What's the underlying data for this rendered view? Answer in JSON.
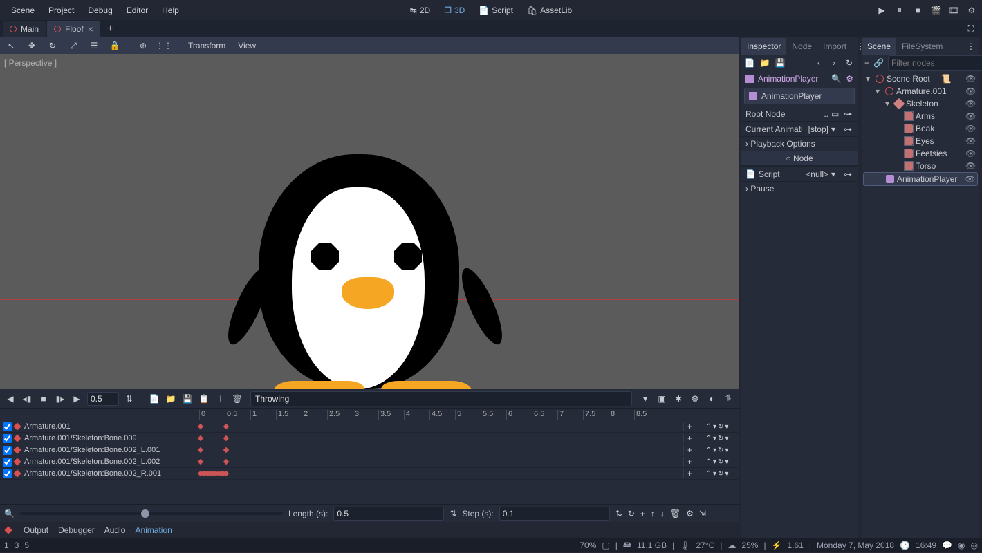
{
  "menubar": {
    "items": [
      "Scene",
      "Project",
      "Debug",
      "Editor",
      "Help"
    ],
    "center": [
      {
        "label": "2D",
        "icon": "swap"
      },
      {
        "label": "3D",
        "icon": "cube",
        "active": true
      },
      {
        "label": "Script",
        "icon": "script"
      },
      {
        "label": "AssetLib",
        "icon": "bag"
      }
    ]
  },
  "tabs": [
    {
      "name": "Main",
      "active": false
    },
    {
      "name": "Floof",
      "active": true,
      "closable": true
    }
  ],
  "toolbar3d": {
    "menus": [
      "Transform",
      "View"
    ]
  },
  "viewport": {
    "label": "[ Perspective ]"
  },
  "animation": {
    "toolbar": {
      "pos": "0.5",
      "name": "Throwing"
    },
    "ruler": [
      "0",
      "0.5",
      "1",
      "1.5",
      "2",
      "2.5",
      "3",
      "3.5",
      "4",
      "4.5",
      "5",
      "5.5",
      "6",
      "6.5",
      "7",
      "7.5",
      "8",
      "8.5"
    ],
    "tracks": [
      {
        "name": "Armature.001",
        "keys": [
          0,
          0.5
        ]
      },
      {
        "name": "Armature.001/Skeleton:Bone.009",
        "keys": [
          0,
          0.5
        ]
      },
      {
        "name": "Armature.001/Skeleton:Bone.002_L.001",
        "keys": [
          0,
          0.5
        ]
      },
      {
        "name": "Armature.001/Skeleton:Bone.002_L.002",
        "keys": [
          0,
          0.5
        ]
      },
      {
        "name": "Armature.001/Skeleton:Bone.002_R.001",
        "keys": [
          0,
          0.05,
          0.1,
          0.15,
          0.2,
          0.25,
          0.3,
          0.35,
          0.4,
          0.45,
          0.5
        ]
      }
    ],
    "bottom": {
      "length_label": "Length (s):",
      "length": "0.5",
      "step_label": "Step (s):",
      "step": "0.1"
    }
  },
  "bottom_tabs": [
    "Output",
    "Debugger",
    "Audio",
    "Animation"
  ],
  "inspector": {
    "tabs": [
      "Inspector",
      "Node",
      "Import"
    ],
    "title": "AnimationPlayer",
    "obj": "AnimationPlayer",
    "rows": {
      "root_node_label": "Root Node",
      "root_node_val": "..",
      "curr_anim_label": "Current Animati",
      "curr_anim_val": "[stop]",
      "playback_label": "Playback Options",
      "node_label": "Node",
      "script_label": "Script",
      "script_val": "<null>",
      "pause_label": "Pause"
    }
  },
  "scene": {
    "tabs": [
      "Scene",
      "FileSystem"
    ],
    "filter_placeholder": "Filter nodes",
    "tree": [
      {
        "label": "Scene Root",
        "depth": 0,
        "type": "spatial",
        "arrow": "▾",
        "script": true
      },
      {
        "label": "Armature.001",
        "depth": 1,
        "type": "spatial",
        "arrow": "▾"
      },
      {
        "label": "Skeleton",
        "depth": 2,
        "type": "bone",
        "arrow": "▾"
      },
      {
        "label": "Arms",
        "depth": 3,
        "type": "mesh"
      },
      {
        "label": "Beak",
        "depth": 3,
        "type": "mesh"
      },
      {
        "label": "Eyes",
        "depth": 3,
        "type": "mesh"
      },
      {
        "label": "Feetsies",
        "depth": 3,
        "type": "mesh"
      },
      {
        "label": "Torso",
        "depth": 3,
        "type": "mesh"
      },
      {
        "label": "AnimationPlayer",
        "depth": 1,
        "type": "anim",
        "selected": true
      }
    ]
  },
  "statusbar": {
    "left": [
      "1",
      "3",
      "5"
    ],
    "right": {
      "pct": "70%",
      "mem": "11.1 GB",
      "temp": "27°C",
      "cloud": "25%",
      "speed": "1.61",
      "date": "Monday  7, May 2018",
      "time": "16:49"
    }
  }
}
